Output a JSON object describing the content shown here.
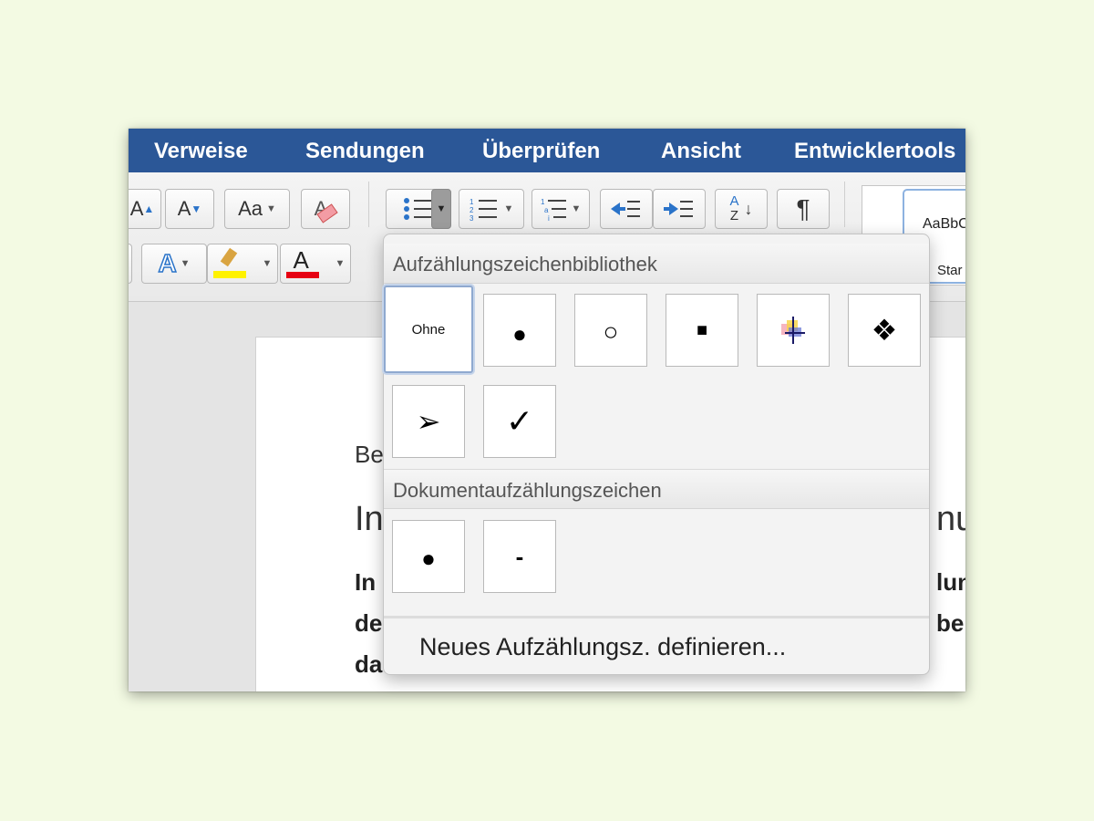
{
  "ribbon": {
    "tabs": [
      "Verweise",
      "Sendungen",
      "Überprüfen",
      "Ansicht",
      "Entwicklertools"
    ]
  },
  "toolbar": {
    "grow_font": "A",
    "shrink_font": "A",
    "change_case": "Aa",
    "clear_format": "A",
    "text_effects": "A",
    "font_color": "A",
    "sort_a": "A",
    "sort_z": "Z",
    "pilcrow": "¶",
    "style_sample": "AaBbC",
    "style_name": "Star",
    "highlight_color": "#fff200",
    "font_color_value": "#e60012"
  },
  "document": {
    "line1": "Be",
    "line2_left": "In",
    "line2_right": "nu",
    "line3_left": "In",
    "line3_right": "lun",
    "line4_left": "de",
    "line4_right": "ber",
    "line5_left": "da"
  },
  "bullet_menu": {
    "library_title": "Aufzählungszeichenbibliothek",
    "library": [
      {
        "label": "Ohne",
        "icon": "none"
      },
      {
        "label": "●",
        "icon": "filled-circle-icon"
      },
      {
        "label": "○",
        "icon": "hollow-circle-icon"
      },
      {
        "label": "■",
        "icon": "filled-square-icon"
      },
      {
        "label": "",
        "icon": "color-picture-bullet-icon"
      },
      {
        "label": "❖",
        "icon": "four-diamonds-icon"
      },
      {
        "label": "➢",
        "icon": "arrowhead-icon"
      },
      {
        "label": "✓",
        "icon": "checkmark-icon"
      }
    ],
    "document_title": "Dokumentaufzählungszeichen",
    "document_bullets": [
      {
        "label": "●",
        "icon": "filled-circle-icon"
      },
      {
        "label": "-",
        "icon": "dash-icon"
      }
    ],
    "define_new": "Neues Aufzählungsz. definieren..."
  }
}
